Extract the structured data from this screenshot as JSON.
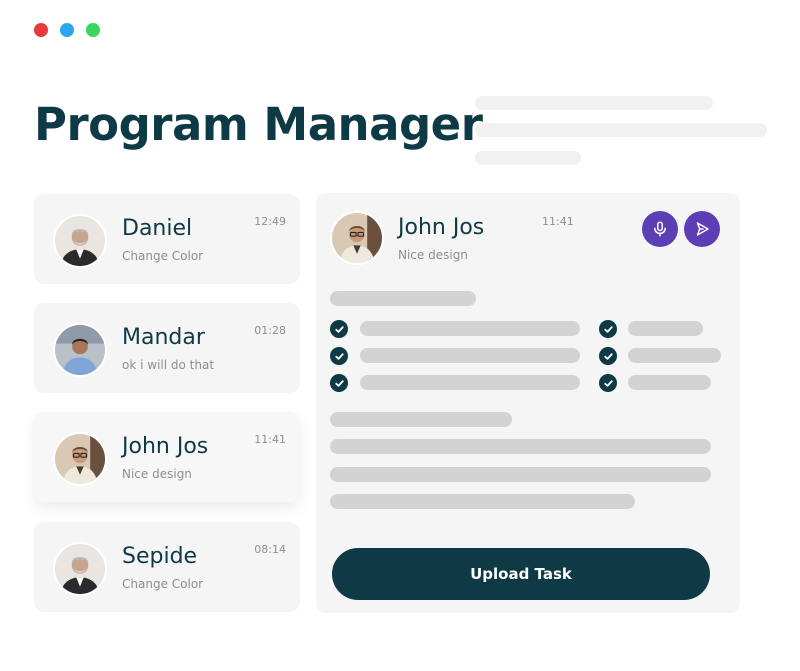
{
  "window": {
    "dots": [
      {
        "name": "close",
        "color": "#e8393b"
      },
      {
        "name": "minimize",
        "color": "#2ba6ef"
      },
      {
        "name": "maximize",
        "color": "#39d75b"
      }
    ]
  },
  "page": {
    "title": "Program Manager"
  },
  "colors": {
    "primary": "#0e3a45",
    "accent_purple": "#5c3fb5",
    "card_bg": "#f5f5f5",
    "skeleton": "#d3d3d3",
    "muted_text": "#8a8f93"
  },
  "conversations": [
    {
      "name": "Daniel",
      "message": "Change Color",
      "time": "12:49",
      "avatar": "older-man-suit-avatar"
    },
    {
      "name": "Mandar",
      "message": "ok i will do  that",
      "time": "01:28",
      "avatar": "young-man-shirt-avatar"
    },
    {
      "name": "John Jos",
      "message": "Nice design",
      "time": "11:41",
      "avatar": "man-glasses-avatar",
      "active": true
    },
    {
      "name": "Sepide",
      "message": "Change Color",
      "time": "08:14",
      "avatar": "older-man-suit-avatar"
    }
  ],
  "detail": {
    "name": "John Jos",
    "message": "Nice design",
    "time": "11:41",
    "icons": [
      "microphone-icon",
      "send-icon"
    ],
    "upload_label": "Upload Task"
  }
}
